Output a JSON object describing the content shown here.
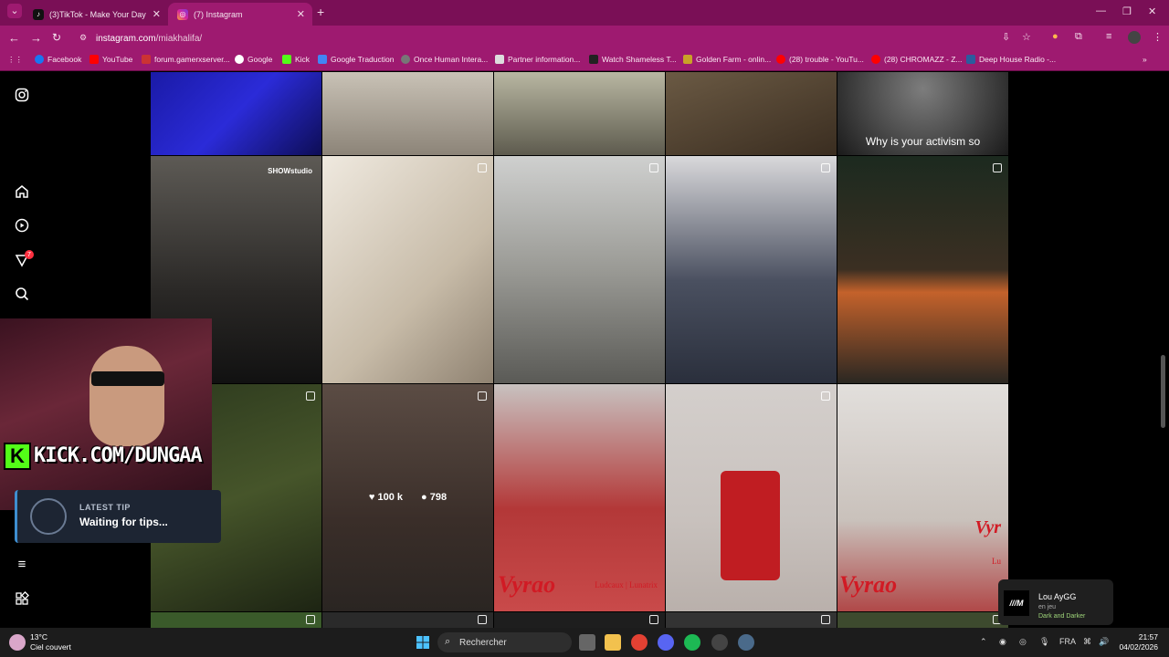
{
  "browser": {
    "tabs": [
      {
        "label": "(3)TikTok - Make Your Day",
        "active": false
      },
      {
        "label": "(7) Instagram",
        "active": true
      }
    ],
    "new_tab_symbol": "+",
    "url_host": "instagram.com",
    "url_path": "/miakhalifa/",
    "bookmarks": [
      "Facebook",
      "YouTube",
      "forum.gamerxserver...",
      "Google",
      "Kick",
      "Google Traduction",
      "Once Human Intera...",
      "Partner information...",
      "Watch Shameless T...",
      "Golden Farm - onlin...",
      "(28) trouble - YouTu...",
      "(28) CHROMAZZ - Z...",
      "Deep House Radio -..."
    ]
  },
  "instagram": {
    "notification_count": "7",
    "top_row_caption": "Why is your activism so",
    "show_label": "SHOWstudio",
    "hover_likes": "100 k",
    "hover_comments": "798",
    "brand_text": "Vyrao",
    "brand_sub": "Ludcaux | Lunatrix",
    "brand_text_right": "Vyr",
    "brand_sub_right": "Lu"
  },
  "stream_overlay": {
    "kick_url": "KICK.COM/DUNGAA",
    "tip_title": "LATEST TIP",
    "tip_text": "Waiting for tips..."
  },
  "notification": {
    "name": "Lou AyGG",
    "status": "en jeu",
    "game": "Dark and Darker"
  },
  "taskbar": {
    "temp": "13°C",
    "weather": "Ciel couvert",
    "search_placeholder": "Rechercher",
    "lang": "FRA",
    "time": "21:57",
    "date": "04/02/2026"
  },
  "colors": {
    "browser_accent": "#9e1a70",
    "tab_bar": "#7a0f56",
    "kick_green": "#53fc18"
  }
}
